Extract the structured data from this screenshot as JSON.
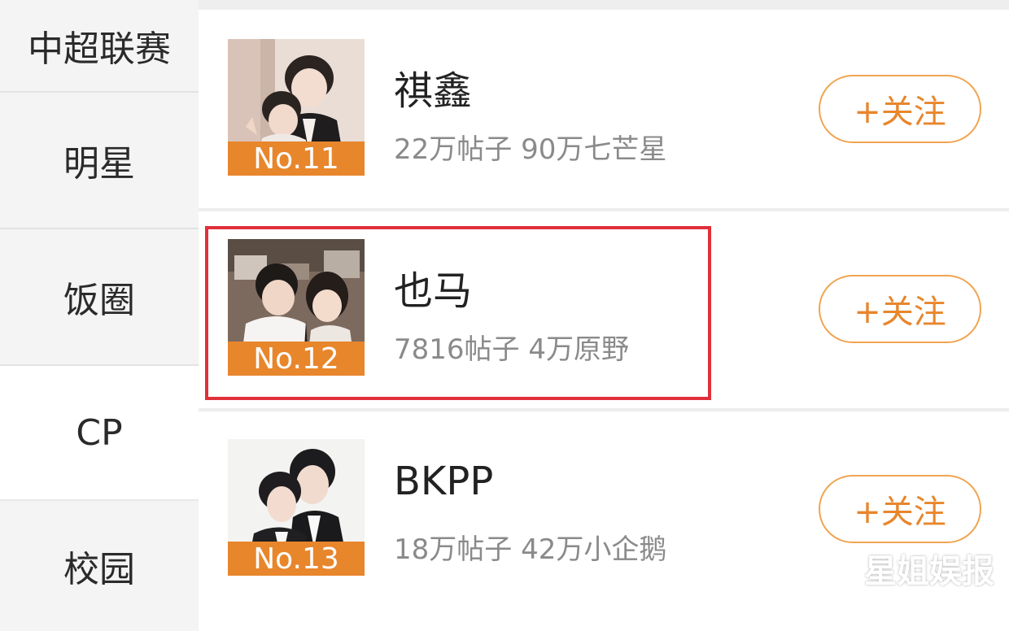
{
  "sidebar": {
    "items": [
      {
        "label": "中超联赛"
      },
      {
        "label": "明星"
      },
      {
        "label": "饭圈"
      },
      {
        "label": "CP"
      },
      {
        "label": "校园"
      }
    ],
    "active": "CP"
  },
  "list": {
    "items": [
      {
        "rank": "No.11",
        "name": "祺鑫",
        "stats": "22万帖子 90万七芒星",
        "follow_label": "+关注"
      },
      {
        "rank": "No.12",
        "name": "也马",
        "stats": "7816帖子 4万原野",
        "follow_label": "+关注"
      },
      {
        "rank": "No.13",
        "name": "BKPP",
        "stats": "18万帖子 42万小企鹅",
        "follow_label": "+关注"
      }
    ]
  },
  "watermark": "星姐娱报",
  "colors": {
    "accent": "#e8862c",
    "highlight": "#e0303a",
    "sidebar_bg": "#f4f4f4"
  }
}
